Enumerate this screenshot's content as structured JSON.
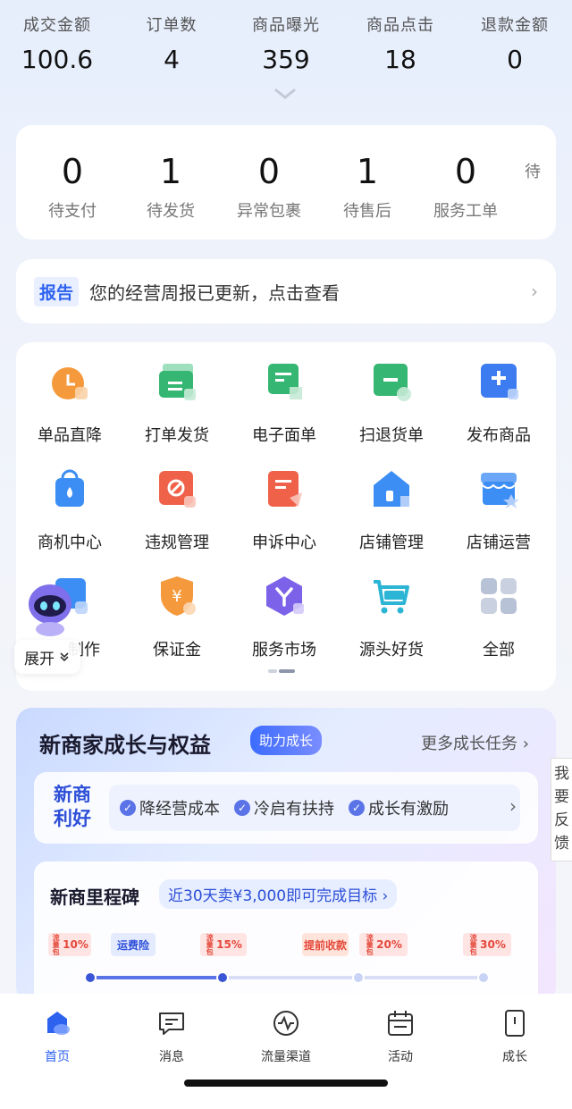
{
  "stats": [
    {
      "label": "成交金额",
      "value": "100.6"
    },
    {
      "label": "订单数",
      "value": "4"
    },
    {
      "label": "商品曝光",
      "value": "359"
    },
    {
      "label": "商品点击",
      "value": "18"
    },
    {
      "label": "退款金额",
      "value": "0"
    }
  ],
  "orders": [
    {
      "count": "0",
      "label": "待支付"
    },
    {
      "count": "1",
      "label": "待发货"
    },
    {
      "count": "0",
      "label": "异常包裹"
    },
    {
      "count": "1",
      "label": "待售后"
    },
    {
      "count": "0",
      "label": "服务工单"
    },
    {
      "count": "",
      "label": "待"
    }
  ],
  "report": {
    "tag": "报告",
    "message": "您的经营周报已更新，点击查看",
    "arrow": "›"
  },
  "tools": [
    {
      "label": "单品直降",
      "icon": "clock-discount-icon",
      "color": "#f59a3c"
    },
    {
      "label": "打单发货",
      "icon": "print-ship-icon",
      "color": "#35b673"
    },
    {
      "label": "电子面单",
      "icon": "e-waybill-icon",
      "color": "#35b673"
    },
    {
      "label": "扫退货单",
      "icon": "scan-return-icon",
      "color": "#35b673"
    },
    {
      "label": "发布商品",
      "icon": "publish-product-icon",
      "color": "#3c7cf0"
    },
    {
      "label": "商机中心",
      "icon": "opportunity-bag-icon",
      "color": "#3c8ef5"
    },
    {
      "label": "违规管理",
      "icon": "violation-icon",
      "color": "#f0614a"
    },
    {
      "label": "申诉中心",
      "icon": "appeal-icon",
      "color": "#f0614a"
    },
    {
      "label": "店铺管理",
      "icon": "store-manage-icon",
      "color": "#3c8ef5"
    },
    {
      "label": "店铺运营",
      "icon": "store-ops-icon",
      "color": "#3c8ef5"
    },
    {
      "label": "制作",
      "icon": "creation-icon",
      "color": "#3c8ef5"
    },
    {
      "label": "保证金",
      "icon": "deposit-shield-icon",
      "color": "#f59a3c"
    },
    {
      "label": "服务市场",
      "icon": "service-market-icon",
      "color": "#7b62e8"
    },
    {
      "label": "源头好货",
      "icon": "source-cart-icon",
      "color": "#2cb5d4"
    },
    {
      "label": "全部",
      "icon": "all-grid-icon",
      "color": "#b8c2d6"
    }
  ],
  "robot": {
    "expand_label": "展开",
    "expand_icon": "double-chevron-down-icon"
  },
  "growth": {
    "title": "新商家成长与权益",
    "badge": "助力成长",
    "more": "更多成长任务",
    "benefit_head": "新商利好",
    "chips": [
      "降经营成本",
      "冷启有扶持",
      "成长有激励"
    ],
    "milestone_title": "新商里程碑",
    "milestone_goal": "近30天卖¥3,000即可完成目标",
    "tickets": [
      {
        "side": "流量包",
        "text": "10%"
      },
      {
        "side": "",
        "text": "运费险"
      },
      {
        "side": "流量包",
        "text": "15%"
      },
      {
        "side": "",
        "text": "提前收款"
      },
      {
        "side": "流量包",
        "text": "20%"
      },
      {
        "side": "流量包",
        "text": "30%"
      }
    ]
  },
  "feedback": [
    "我",
    "要",
    "反",
    "馈"
  ],
  "bottom_nav": [
    {
      "label": "首页",
      "icon": "home-icon",
      "active": true
    },
    {
      "label": "消息",
      "icon": "message-icon",
      "active": false
    },
    {
      "label": "流量渠道",
      "icon": "traffic-channel-icon",
      "active": false
    },
    {
      "label": "活动",
      "icon": "calendar-activity-icon",
      "active": false
    },
    {
      "label": "成长",
      "icon": "growth-icon",
      "active": false
    }
  ],
  "colors": {
    "accent": "#2d62ef",
    "page_bg": "#eef2fb"
  }
}
